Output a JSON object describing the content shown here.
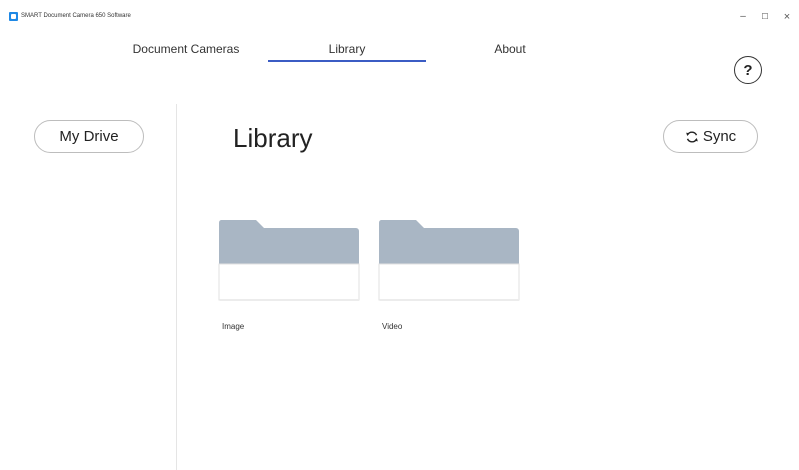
{
  "window": {
    "title": "SMART Document Camera 650 Software",
    "minimize_glyph": "–",
    "maximize_glyph": "☐",
    "close_glyph": "×"
  },
  "tabs": [
    {
      "label": "Document Cameras",
      "selected": false
    },
    {
      "label": "Library",
      "selected": true
    },
    {
      "label": "About",
      "selected": false
    }
  ],
  "help": {
    "label": "?",
    "icon": "help-icon"
  },
  "sidebar": {
    "my_drive_label": "My Drive"
  },
  "main": {
    "title": "Library",
    "sync_label": "Sync",
    "sync_icon": "refresh-icon",
    "folders": [
      {
        "name": "Image",
        "icon": "folder-icon"
      },
      {
        "name": "Video",
        "icon": "folder-icon"
      }
    ]
  },
  "colors": {
    "accent": "#3b5cc4",
    "folder_tab": "#a9b6c4",
    "folder_body": "#ffffff",
    "border": "#bdbdbd"
  }
}
